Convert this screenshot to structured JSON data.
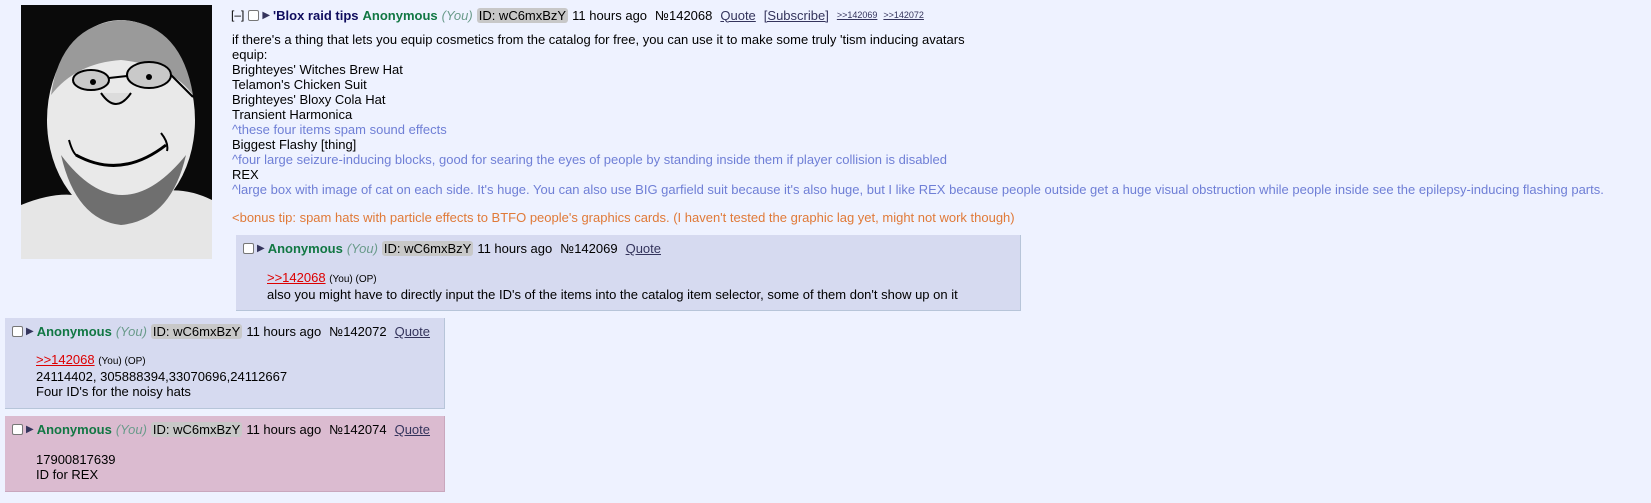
{
  "op": {
    "collapse": "[–]",
    "subject": "'Blox raid tips",
    "name": "Anonymous",
    "you": "(You)",
    "poster_id": "ID: wC6mxBzY",
    "time": "11 hours ago",
    "number": "№142068",
    "quote": "Quote",
    "subscribe": "[Subscribe]",
    "backlinks": [
      ">>142069",
      ">>142072"
    ],
    "lines": [
      "if there's a thing that lets you equip cosmetics from the catalog for free, you can use it to make some truly 'tism inducing avatars",
      "equip:",
      "Brighteyes' Witches Brew Hat",
      "Telamon's Chicken Suit",
      "Brighteyes' Bloxy Cola Hat",
      "Transient Harmonica",
      "^these four items spam sound effects",
      "Biggest Flashy [thing]",
      "^four large seizure-inducing blocks, good for searing the eyes of people by standing inside them if player collision is disabled",
      "REX",
      "^large box with image of cat on each side. It's huge. You can also use BIG garfield suit because it's also huge, but I like REX because people outside get a huge visual obstruction while people inside see the epilepsy-inducing flashing parts.",
      "<bonus tip: spam hats with particle effects to BTFO people's graphics cards. (I haven't tested the graphic lag yet, might not work though)"
    ]
  },
  "replies": [
    {
      "name": "Anonymous",
      "you": "(You)",
      "poster_id": "ID: wC6mxBzY",
      "time": "11 hours ago",
      "number": "№142069",
      "quote": "Quote",
      "quotelink": ">>142068",
      "quotelink_suffix": "(You) (OP)",
      "lines": [
        "also you might have to directly input the ID's of the items into the catalog item selector, some of them don't show up on it"
      ]
    },
    {
      "name": "Anonymous",
      "you": "(You)",
      "poster_id": "ID: wC6mxBzY",
      "time": "11 hours ago",
      "number": "№142072",
      "quote": "Quote",
      "quotelink": ">>142068",
      "quotelink_suffix": "(You) (OP)",
      "lines": [
        "24114402, 305888394,33070696,24112667",
        "Four ID's for the noisy hats"
      ]
    },
    {
      "name": "Anonymous",
      "you": "(You)",
      "poster_id": "ID: wC6mxBzY",
      "time": "11 hours ago",
      "number": "№142074",
      "quote": "Quote",
      "lines": [
        "17900817639",
        "ID for REX"
      ]
    }
  ]
}
